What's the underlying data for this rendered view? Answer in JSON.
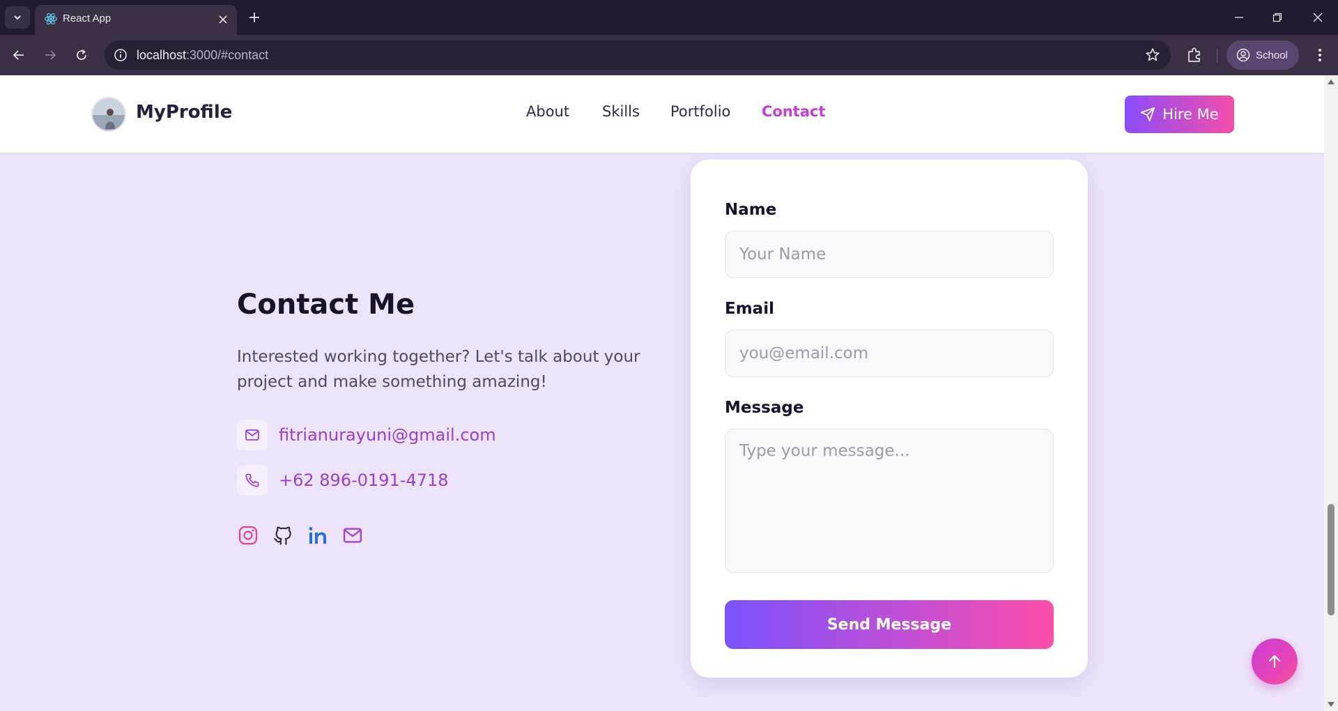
{
  "browser": {
    "tab_title": "React App",
    "url_host": "localhost",
    "url_rest": ":3000/#contact",
    "profile_label": "School"
  },
  "header": {
    "brand": "MyProfile",
    "nav": [
      {
        "label": "About",
        "active": false
      },
      {
        "label": "Skills",
        "active": false
      },
      {
        "label": "Portfolio",
        "active": false
      },
      {
        "label": "Contact",
        "active": true
      }
    ],
    "hire_label": "Hire Me"
  },
  "contact": {
    "title": "Contact Me",
    "description": "Interested working together? Let's talk about your project and make something amazing!",
    "email": "fitrianurayuni@gmail.com",
    "phone": "+62 896-0191-4718",
    "socials": [
      "instagram-icon",
      "github-icon",
      "linkedin-icon",
      "mail-icon"
    ]
  },
  "form": {
    "name_label": "Name",
    "name_placeholder": "Your Name",
    "email_label": "Email",
    "email_placeholder": "you@email.com",
    "message_label": "Message",
    "message_placeholder": "Type your message...",
    "submit_label": "Send Message"
  },
  "colors": {
    "accent_purple": "#8a4cf8",
    "accent_pink": "#f54ea9",
    "page_bg": "#ede4fb",
    "active_nav": "#c23fd2"
  }
}
